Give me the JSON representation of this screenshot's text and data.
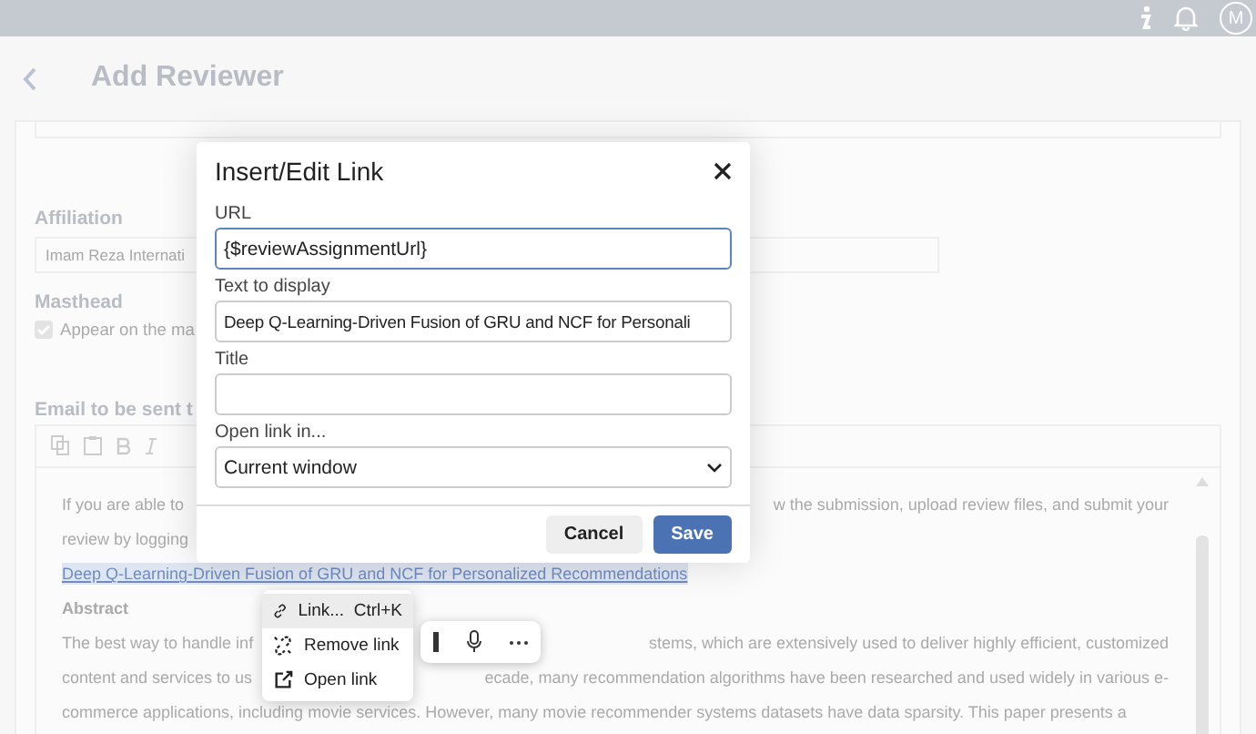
{
  "topbar": {
    "avatar": "M"
  },
  "header": {
    "title": "Add Reviewer"
  },
  "form": {
    "affiliation": {
      "label": "Affiliation",
      "value": "Imam Reza Internati"
    },
    "masthead": {
      "label": "Masthead",
      "checkbox_label": "Appear on the ma",
      "checked": true
    },
    "email": {
      "label": "Email to be sent t",
      "body": [
        {
          "kind": "text",
          "left": "If you are able to",
          "right": "w the submission, upload review files, and submit your"
        },
        {
          "kind": "text",
          "left": "review by logging"
        },
        {
          "kind": "link",
          "text": "Deep Q-Learning-Driven Fusion of GRU and NCF for Personalized Recommendations"
        },
        {
          "kind": "heading",
          "text": "Abstract"
        },
        {
          "kind": "text",
          "left": "The best way to handle inf",
          "right": "stems, which are extensively used to deliver highly efficient, customized"
        },
        {
          "kind": "text",
          "left": "content and services to us",
          "right": "ecade, many recommendation algorithms have been researched and used widely in various e-"
        },
        {
          "kind": "text",
          "left": "commerce applications, including movie services. However, many movie recommender systems datasets have data sparsity. This paper presents a"
        }
      ]
    }
  },
  "dialog": {
    "title": "Insert/Edit Link",
    "fields": [
      {
        "kind": "input",
        "label": "URL",
        "value": "{$reviewAssignmentUrl}",
        "focused": true
      },
      {
        "kind": "input",
        "label": "Text to display",
        "value": "Deep Q-Learning-Driven Fusion of GRU and NCF for Personali",
        "focused": false
      },
      {
        "kind": "input",
        "label": "Title",
        "focused": false
      },
      {
        "kind": "select",
        "label": "Open link in...",
        "value": "Current window",
        "focused": false
      }
    ],
    "buttons": [
      {
        "label": "Cancel",
        "kind": "secondary"
      },
      {
        "label": "Save",
        "kind": "primary"
      }
    ]
  },
  "context_menu": {
    "items": [
      {
        "kind": "link",
        "label": "Link...",
        "shortcut": "Ctrl+K",
        "selected": true
      },
      {
        "kind": "unlink",
        "label": "Remove link",
        "selected": false
      },
      {
        "kind": "open",
        "label": "Open link",
        "selected": false
      }
    ]
  }
}
